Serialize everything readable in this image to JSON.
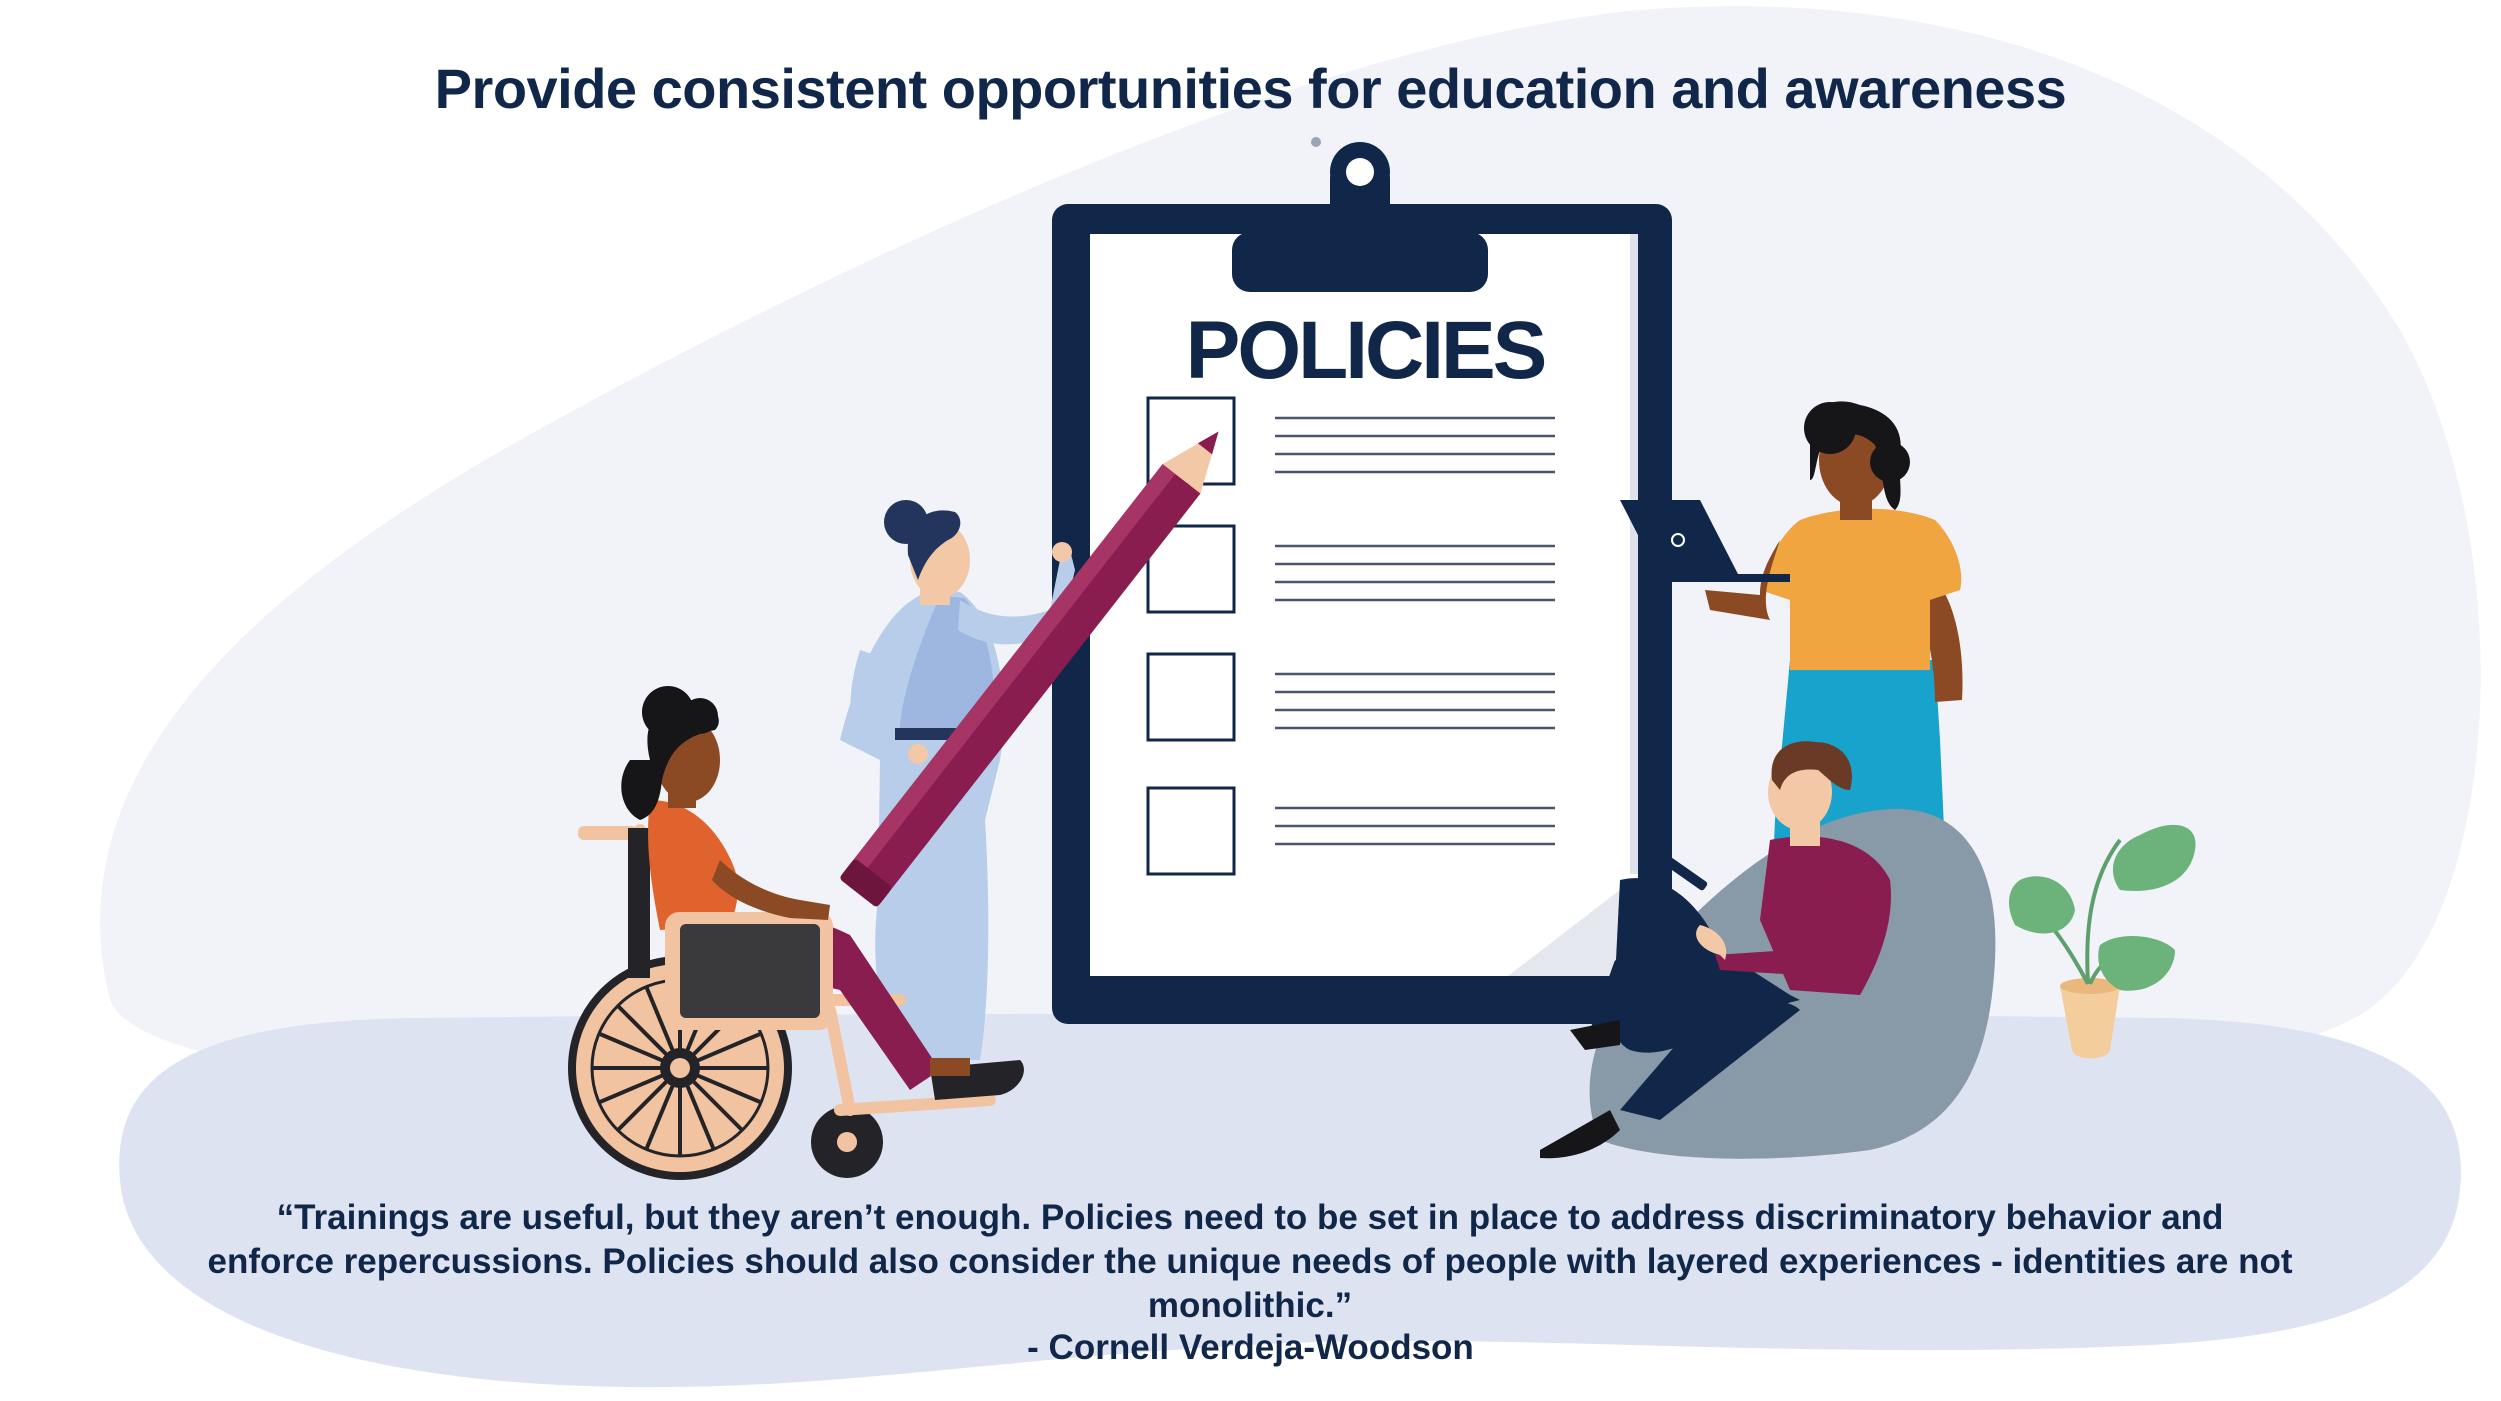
{
  "title": "Provide consistent opportunities for education and awareness",
  "clipboard": {
    "heading": "POLICIES",
    "checkbox_count": 4
  },
  "quote": {
    "line1": "“Trainings are useful, but they aren’t enough. Policies need to be set in place to address discriminatory behavior and",
    "line2": "enforce repercussions. Policies should also consider the unique needs of people with layered experiences - identities are not monolithic.”"
  },
  "attribution": "- Cornell Verdeja-Woodson",
  "colors": {
    "navy": "#10274a",
    "background_blob": "#f1f3f8",
    "floor": "#dde3f1",
    "pencil": "#8a1d4f",
    "shirt_orange": "#f0a541",
    "pants_blue": "#17a3cc",
    "beanbag": "#8899a8",
    "plant": "#6bb37a"
  }
}
